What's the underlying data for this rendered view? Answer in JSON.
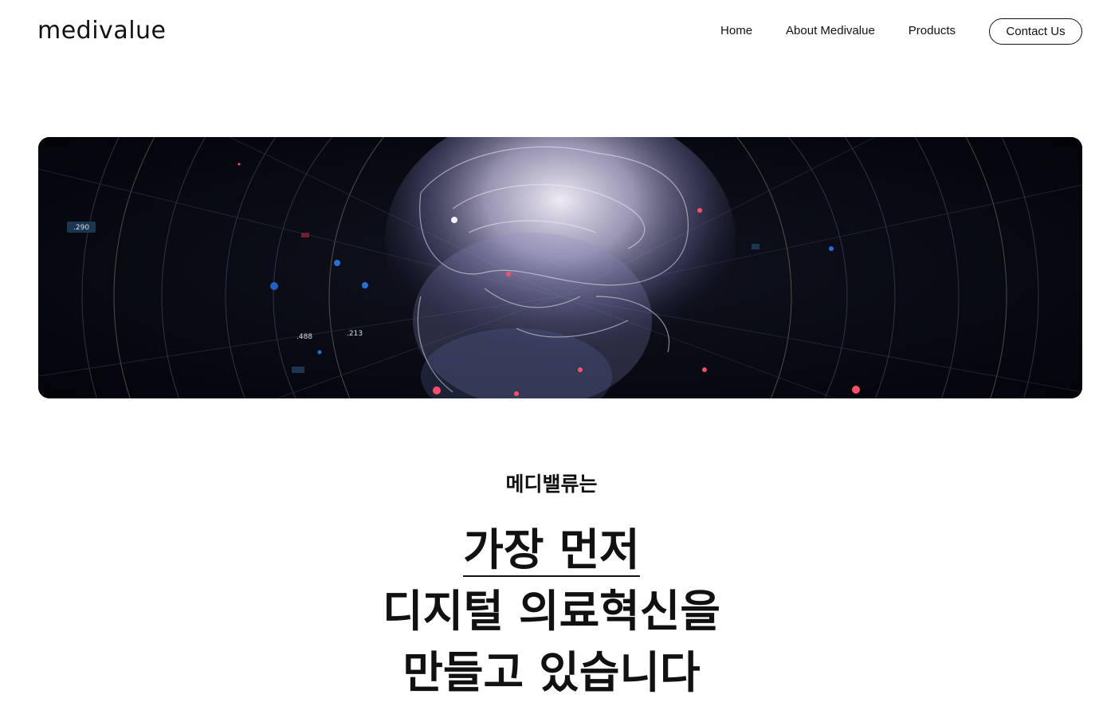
{
  "header": {
    "logo_text": "medivalue",
    "nav": [
      {
        "label": "Home"
      },
      {
        "label": "About Medivalue"
      },
      {
        "label": "Products"
      }
    ],
    "contact_label": "Contact Us"
  },
  "hero": {
    "readouts": [
      ".290",
      ".488",
      ".213"
    ]
  },
  "intro": {
    "subtitle": "메디밸류는",
    "headline_line1": "가장 먼저",
    "headline_line2": "디지털 의료혁신을",
    "headline_line3": "만들고 있습니다"
  },
  "colors": {
    "text": "#111111",
    "background": "#ffffff",
    "hero_background": "#05060d"
  }
}
